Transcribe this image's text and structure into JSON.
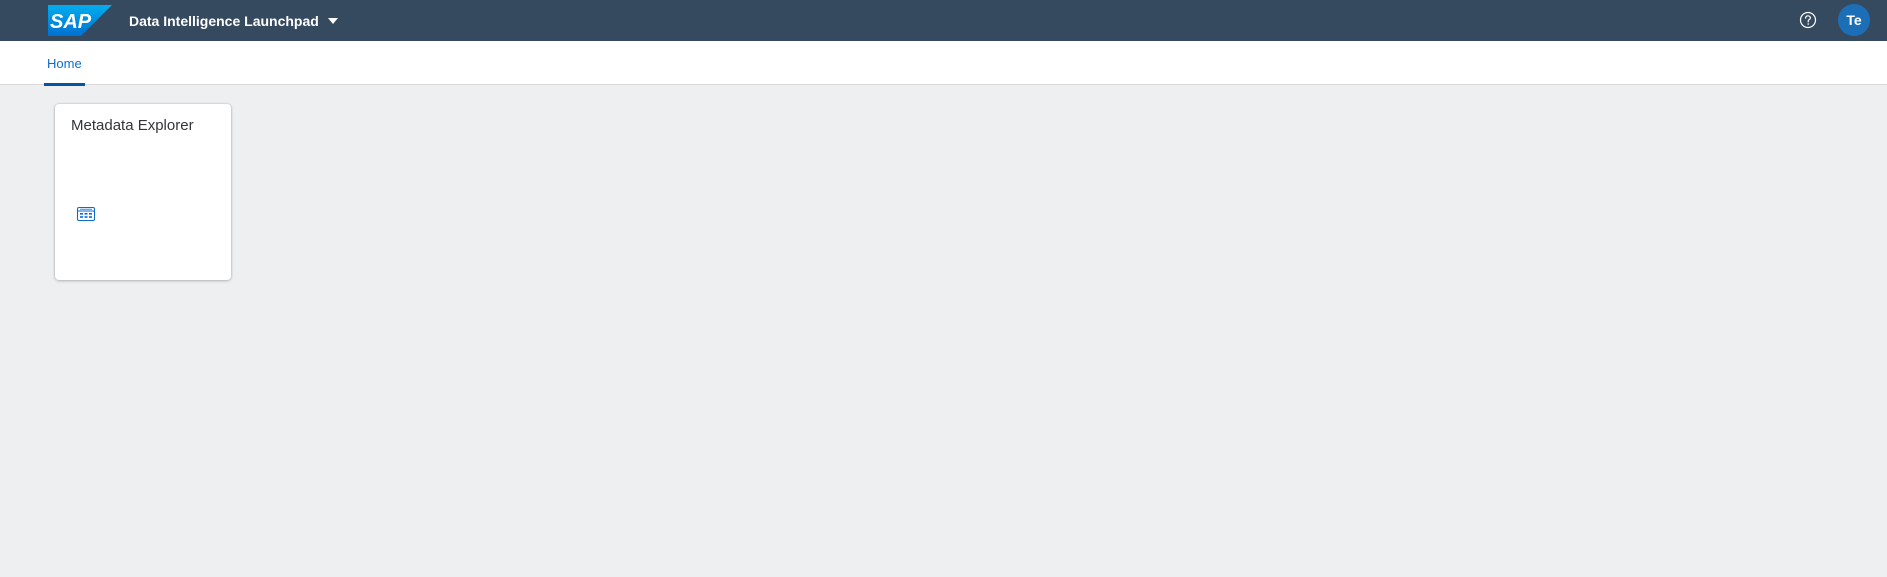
{
  "shell": {
    "logo_text": "SAP",
    "app_title": "Data Intelligence Launchpad",
    "help_icon": "question-mark-circle-icon",
    "avatar_initials": "Te"
  },
  "tabs": [
    {
      "label": "Home",
      "selected": true
    }
  ],
  "tiles": [
    {
      "title": "Metadata Explorer",
      "icon": "catalog-icon"
    }
  ],
  "colors": {
    "shell_bg": "#354a5f",
    "page_bg": "#edeff0",
    "accent": "#0854a0",
    "avatar_bg": "#1c6fb7",
    "icon_color": "#0a6ed1"
  }
}
